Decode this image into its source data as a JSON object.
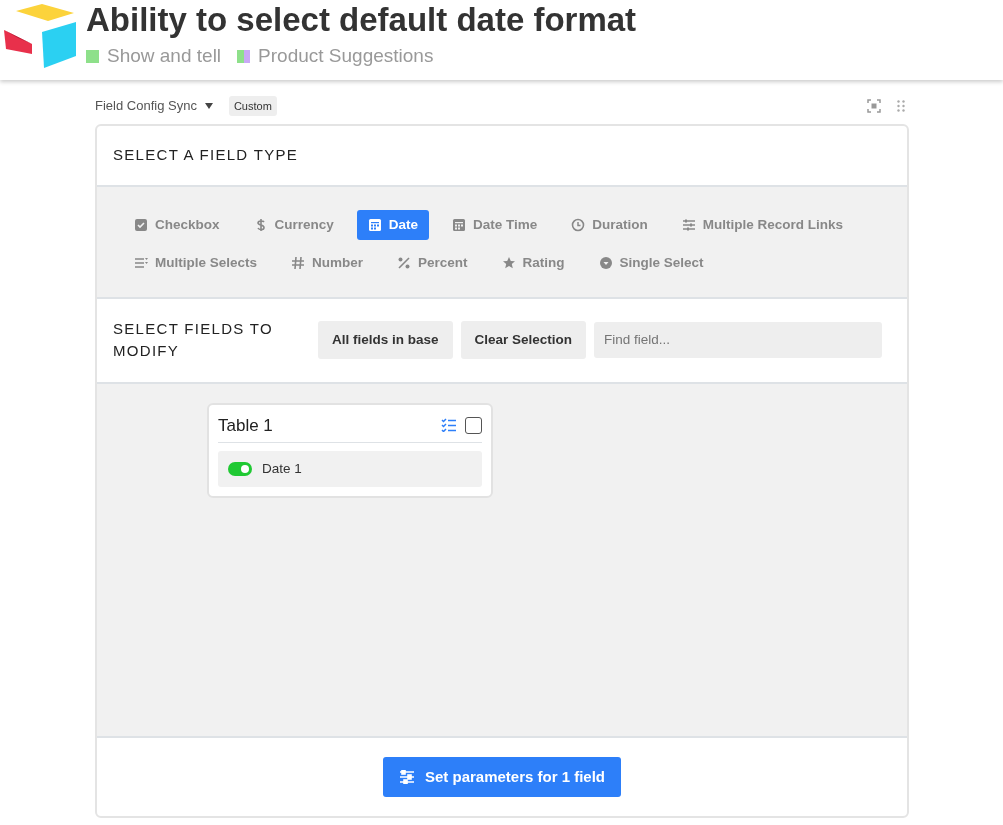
{
  "header": {
    "title": "Ability to select default date format",
    "tags": [
      {
        "label": "Show and tell",
        "swatches": [
          {
            "color": "#8ee08a"
          }
        ]
      },
      {
        "label": "Product Suggestions",
        "swatches": [
          {
            "color": "#8ee08a"
          },
          {
            "color": "#c9a9f6"
          }
        ]
      }
    ]
  },
  "widget": {
    "name": "Field Config Sync",
    "badge": "Custom"
  },
  "field_type_section": {
    "heading": "SELECT A FIELD TYPE",
    "types": [
      {
        "label": "Checkbox",
        "kind": "checkbox",
        "selected": false
      },
      {
        "label": "Currency",
        "kind": "currency",
        "selected": false
      },
      {
        "label": "Date",
        "kind": "date",
        "selected": true
      },
      {
        "label": "Date Time",
        "kind": "date",
        "selected": false
      },
      {
        "label": "Duration",
        "kind": "clock",
        "selected": false
      },
      {
        "label": "Multiple Record Links",
        "kind": "links",
        "selected": false
      },
      {
        "label": "Multiple Selects",
        "kind": "multiselect",
        "selected": false
      },
      {
        "label": "Number",
        "kind": "number",
        "selected": false
      },
      {
        "label": "Percent",
        "kind": "percent",
        "selected": false
      },
      {
        "label": "Rating",
        "kind": "star",
        "selected": false
      },
      {
        "label": "Single Select",
        "kind": "single",
        "selected": false
      }
    ]
  },
  "fields_section": {
    "heading": "SELECT FIELDS TO MODIFY",
    "buttons": [
      "All fields in base",
      "Clear Selection"
    ],
    "search": {
      "placeholder": "Find field..."
    }
  },
  "tables": [
    {
      "title": "Table 1",
      "checked": false,
      "fields": [
        {
          "name": "Date 1",
          "on": true
        }
      ]
    }
  ],
  "footer": {
    "button": "Set parameters for 1 field"
  }
}
